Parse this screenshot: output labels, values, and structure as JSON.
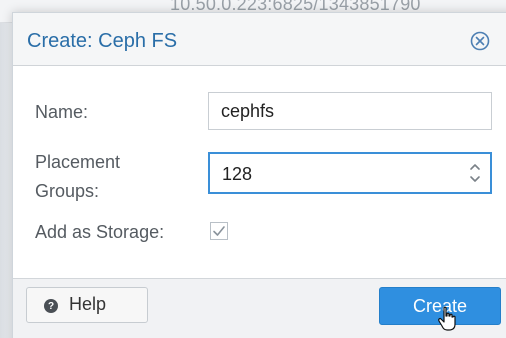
{
  "background": {
    "text": "10.50.0.223:6825/1343851790"
  },
  "dialog": {
    "title": "Create: Ceph FS",
    "fields": {
      "name_label": "Name:",
      "name_value": "cephfs",
      "pg_label": "Placement Groups:",
      "pg_value": "128",
      "storage_label": "Add as Storage:",
      "storage_checked": true
    },
    "buttons": {
      "help": "Help",
      "create": "Create"
    }
  },
  "colors": {
    "accent": "#2f8fe0",
    "title": "#2a6ea8"
  },
  "icons": {
    "close": "close-circle-icon",
    "help": "help-circle-icon",
    "spinner": "up-down-spinner-icon",
    "checkbox": "checkmark-icon",
    "cursor": "hand-cursor-icon"
  }
}
